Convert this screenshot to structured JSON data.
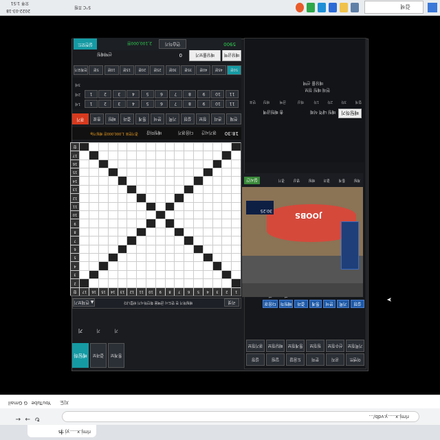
{
  "taskbar": {
    "search_text": "검색",
    "tray_time": "오후 1:51",
    "tray_date": "2022-03-18",
    "tray_weather": "5°C 흐림"
  },
  "browser": {
    "tab1": "rlmj.x.....yj .js",
    "tab_new": "+",
    "address": "rlmj.x.....y.vdb/...",
    "bookmarks": [
      "G Gmail",
      "YouTube",
      "지도"
    ]
  },
  "app": {
    "top": {
      "score_label": "총점",
      "score_value": "5900",
      "mode_button": "연습하기",
      "mode_value": "2,100,000원",
      "mode_button_right": "실전모드"
    },
    "second": {
      "left_btn": "선택배팅",
      "left_btn2": "배당률보기",
      "value": "0",
      "right_label": "배당금액설정"
    },
    "colors": {
      "accent": "#159aa3",
      "danger": "#d63a1e",
      "blue": "#1e5aa8"
    },
    "odds_row": [
      "전체보기",
      "5분",
      "10분",
      "15분",
      "20분",
      "25분",
      "30분",
      "35분",
      "40분",
      "45분",
      "50분"
    ],
    "num_rows": {
      "row1_label": "1세",
      "row2_label": "2세",
      "row3_label": "3세",
      "numbers": [
        "1",
        "2",
        "3",
        "4",
        "5",
        "6",
        "7",
        "8",
        "9",
        "10",
        "11"
      ]
    },
    "tab_row": [
      "경기",
      "종료",
      "베팅",
      "결과",
      "통계",
      "분석",
      "기록",
      "설정",
      "정보",
      "관리",
      "전체"
    ],
    "status": {
      "time": "18:30",
      "label1": "경기시간",
      "label2": "다음경기",
      "label3": "배팅마감",
      "label4": "경기번호 1,000,000원 배팅가능"
    },
    "matrix": {
      "corner": "합",
      "col_headers": [
        "1",
        "2",
        "3",
        "4",
        "5",
        "6",
        "7",
        "8",
        "9",
        "10",
        "11",
        "12",
        "13",
        "14",
        "15",
        "16",
        "17",
        "합"
      ],
      "row_headers": [
        "1",
        "2",
        "3",
        "4",
        "5",
        "6",
        "7",
        "8",
        "9",
        "10",
        "11",
        "12",
        "13",
        "14",
        "15",
        "16",
        "17",
        "합"
      ]
    },
    "grid_footer": {
      "left": "리셋",
      "middle": "배팅하기 전 반드시 금액을 확인하시기 바랍니다",
      "right": "▲ 전체보기"
    },
    "bottom_tabs": [
      "베팅하기",
      "결과보기",
      "통계보기"
    ],
    "right_panel": {
      "header_lines": [
        "현재 배팅 정보",
        "배당률 선택"
      ],
      "table_headers": [
        "번호",
        "배당",
        "금액",
        "예상",
        "1차",
        "2차",
        "3차",
        "합계"
      ],
      "footer_left": "배팅 내역 삭제",
      "footer_right": "총 배팅금액",
      "footer_btn": "배팅하기"
    },
    "video": {
      "tabs": [
        "실시간",
        "경기",
        "영상",
        "배팅",
        "결과",
        "통계",
        "채팅"
      ],
      "scoreboard": [
        "1",
        "2",
        "3",
        "4",
        "5",
        "6",
        "7"
      ],
      "logo_text": "JOOBS",
      "score_left": "30:25",
      "score_label": "SET 3"
    },
    "video_buttons": [
      "다음경기",
      "배팅하기",
      "결과",
      "통계",
      "분석",
      "기록",
      "설정"
    ],
    "bottom_buttons": {
      "row1": [
        "경기정보",
        "배당정보",
        "통계정보",
        "팀정보",
        "선수정보",
        "기록정보"
      ],
      "row2": [
        "설정",
        "알림",
        "도움말",
        "문의",
        "공지",
        "이벤트"
      ]
    }
  }
}
